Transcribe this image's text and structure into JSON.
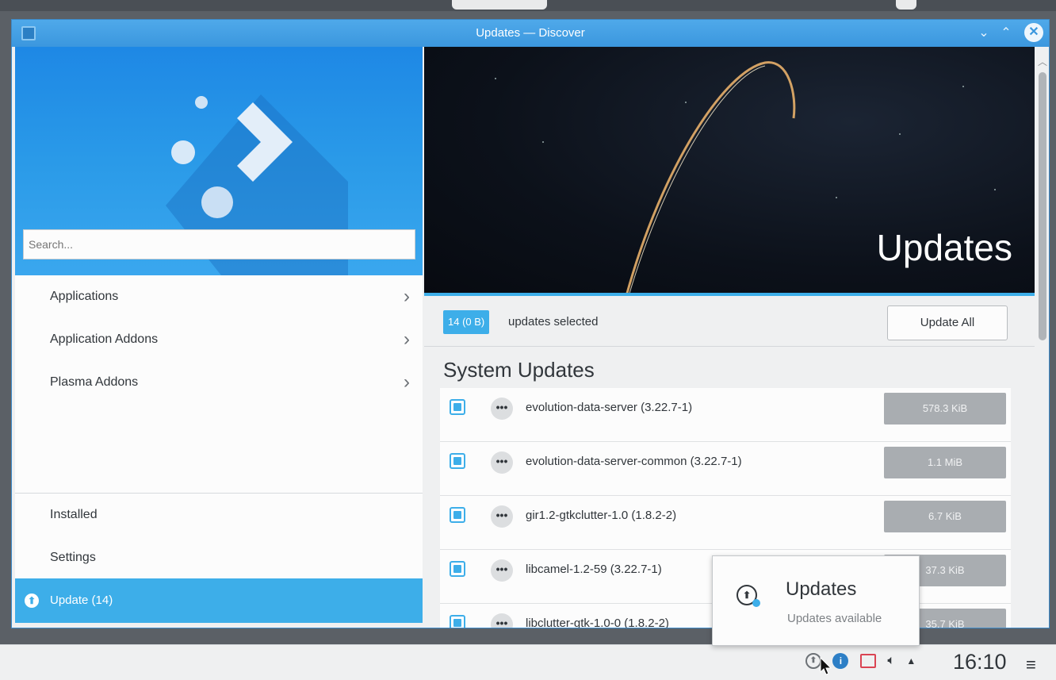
{
  "window": {
    "title": "Updates — Discover",
    "minimize_label": "⌄",
    "maximize_label": "⌃",
    "close_label": "✕"
  },
  "sidebar": {
    "search_placeholder": "Search...",
    "items": [
      {
        "label": "Applications"
      },
      {
        "label": "Application Addons"
      },
      {
        "label": "Plasma Addons"
      }
    ],
    "bottom_items": [
      {
        "label": "Installed"
      },
      {
        "label": "Settings"
      }
    ],
    "active_item": {
      "label": "Update (14)"
    }
  },
  "main": {
    "hero_title": "Updates",
    "selection": {
      "badge": "14 (0 B)",
      "text": "updates selected",
      "update_all_label": "Update All"
    },
    "section_title": "System Updates",
    "updates": [
      {
        "name": "evolution-data-server (3.22.7-1)",
        "size": "578.3 KiB"
      },
      {
        "name": "evolution-data-server-common (3.22.7-1)",
        "size": "1.1 MiB"
      },
      {
        "name": "gir1.2-gtkclutter-1.0 (1.8.2-2)",
        "size": "6.7 KiB"
      },
      {
        "name": "libcamel-1.2-59 (3.22.7-1)",
        "size": "37.3 KiB"
      },
      {
        "name": "libclutter-gtk-1.0-0 (1.8.2-2)",
        "size": "35.7 KiB"
      }
    ]
  },
  "notification": {
    "title": "Updates",
    "subtitle": "Updates available"
  },
  "taskbar": {
    "clock": "16:10",
    "menu_icon": "≡",
    "tray_icons": [
      "updates-icon",
      "accessibility-icon",
      "network-icon",
      "volume-icon",
      "expand-tray-icon"
    ]
  },
  "colors": {
    "accent": "#3daee9",
    "titlebar": "#3b97de",
    "size_badge": "#a9adb1",
    "text": "#31363b"
  }
}
